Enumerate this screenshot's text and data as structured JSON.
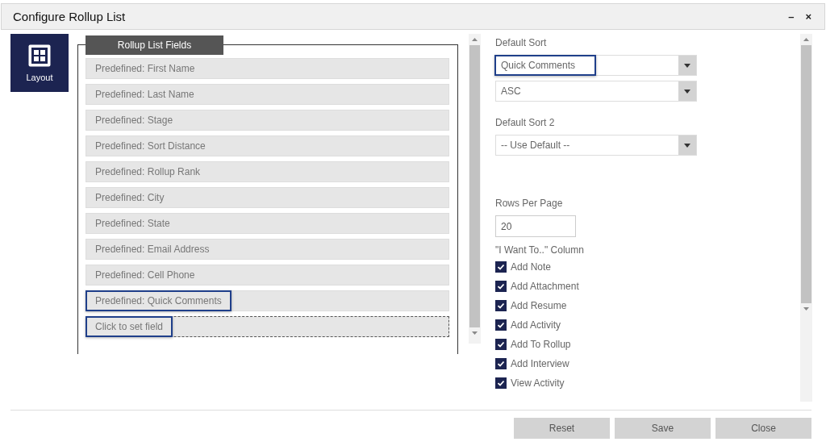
{
  "window": {
    "title": "Configure Rollup List",
    "controls": [
      "–",
      "×"
    ]
  },
  "nav": {
    "label": "Layout",
    "selected": true
  },
  "fields_panel": {
    "legend": "Rollup List Fields",
    "fields": [
      {
        "label": "Predefined: First Name",
        "kind": "field",
        "highlighted": false
      },
      {
        "label": "Predefined: Last Name",
        "kind": "field",
        "highlighted": false
      },
      {
        "label": "Predefined: Stage",
        "kind": "field",
        "highlighted": false
      },
      {
        "label": "Predefined: Sort Distance",
        "kind": "field",
        "highlighted": false
      },
      {
        "label": "Predefined: Rollup Rank",
        "kind": "field",
        "highlighted": false
      },
      {
        "label": "Predefined: City",
        "kind": "field",
        "highlighted": false
      },
      {
        "label": "Predefined: State",
        "kind": "field",
        "highlighted": false
      },
      {
        "label": "Predefined: Email Address",
        "kind": "field",
        "highlighted": false
      },
      {
        "label": "Predefined: Cell Phone",
        "kind": "field",
        "highlighted": false
      },
      {
        "label": "Predefined: Quick Comments",
        "kind": "field",
        "highlighted": true
      },
      {
        "label": "Click to set field",
        "kind": "empty",
        "highlighted": true
      }
    ]
  },
  "settings": {
    "default_sort": {
      "label": "Default Sort",
      "value": "Quick Comments",
      "highlighted": true,
      "order": "ASC"
    },
    "default_sort_2": {
      "label": "Default Sort 2",
      "value": "-- Use Default --"
    },
    "rows_per_page": {
      "label": "Rows Per Page",
      "value": "20"
    },
    "i_want_to": {
      "label": "\"I Want To..\" Column",
      "options": [
        {
          "label": "Add Note",
          "checked": true
        },
        {
          "label": "Add Attachment",
          "checked": true
        },
        {
          "label": "Add Resume",
          "checked": true
        },
        {
          "label": "Add Activity",
          "checked": true
        },
        {
          "label": "Add To Rollup",
          "checked": true
        },
        {
          "label": "Add Interview",
          "checked": true
        },
        {
          "label": "View Activity",
          "checked": true
        }
      ]
    }
  },
  "buttons": [
    "Reset",
    "Save",
    "Close"
  ]
}
